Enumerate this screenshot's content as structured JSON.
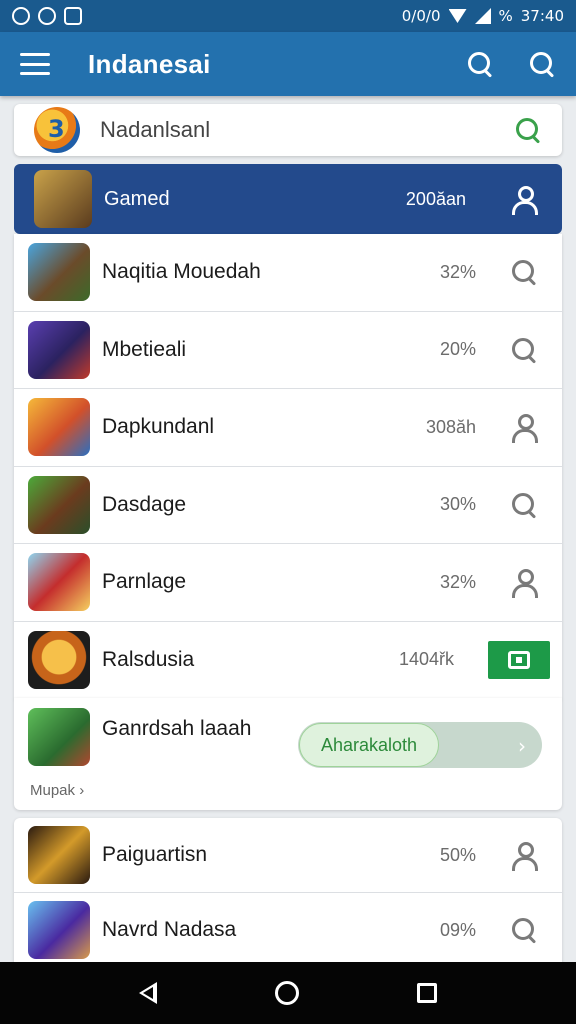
{
  "status_bar": {
    "network_text": "0/0/0",
    "battery_text": "%",
    "time": "37:40"
  },
  "app_bar": {
    "title": "Indanesai"
  },
  "search": {
    "placeholder": "Nadanlsanl"
  },
  "featured": {
    "title": "Gamed",
    "stat": "200ăan"
  },
  "games": [
    {
      "name": "Naqitia Mouedah",
      "stat": "32%",
      "action_icon": "search-icon"
    },
    {
      "name": "Mbetieali",
      "stat": "20%",
      "action_icon": "search-icon"
    },
    {
      "name": "Dapkundanl",
      "stat": "308ăh",
      "action_icon": "user-icon"
    },
    {
      "name": "Dasdage",
      "stat": "30%",
      "action_icon": "search-icon"
    },
    {
      "name": "Parnlage",
      "stat": "32%",
      "action_icon": "user-icon"
    },
    {
      "name": "Ralsdusia",
      "stat": "1404řk",
      "action_icon": "download-icon"
    }
  ],
  "promo": {
    "name": "Ganrdsah laaah",
    "toggle_label": "Aharakaloth",
    "more_label": "Mupak ›"
  },
  "games_2": [
    {
      "name": "Paiguartisn",
      "stat": "50%",
      "action_icon": "user-icon"
    },
    {
      "name": "Navrd Nadasa",
      "stat": "09%",
      "action_icon": "search-icon"
    }
  ],
  "colors": {
    "status_bar": "#1a5a8e",
    "app_bar": "#2371ae",
    "featured": "#234a8c",
    "accent_green": "#1d9a48"
  }
}
